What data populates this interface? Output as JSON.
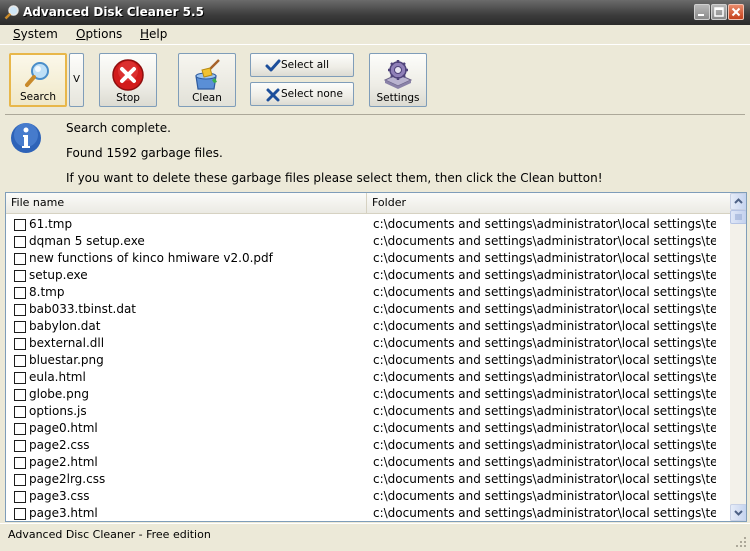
{
  "window": {
    "title": "Advanced Disk Cleaner 5.5"
  },
  "menu": {
    "items": [
      {
        "label": "System",
        "hotkey": "S",
        "rest": "ystem"
      },
      {
        "label": "Options",
        "hotkey": "O",
        "rest": "ptions"
      },
      {
        "label": "Help",
        "hotkey": "H",
        "rest": "elp"
      }
    ]
  },
  "toolbar": {
    "search_label": "Search",
    "dropdown_label": "V",
    "stop_label": "Stop",
    "clean_label": "Clean",
    "select_all_label": "Select all",
    "select_none_label": "Select none",
    "settings_label": "Settings"
  },
  "info": {
    "line1": "Search complete.",
    "line2": "Found 1592 garbage files.",
    "line3": "If you want to delete these garbage files please select them, then click the Clean button!"
  },
  "list": {
    "headers": {
      "file_name": "File name",
      "folder": "Folder"
    },
    "rows": [
      {
        "name": "61.tmp",
        "folder": "c:\\documents and settings\\administrator\\local settings\\te..."
      },
      {
        "name": "dqman 5 setup.exe",
        "folder": "c:\\documents and settings\\administrator\\local settings\\te..."
      },
      {
        "name": "new functions of kinco hmiware v2.0.pdf",
        "folder": "c:\\documents and settings\\administrator\\local settings\\te..."
      },
      {
        "name": "setup.exe",
        "folder": "c:\\documents and settings\\administrator\\local settings\\te..."
      },
      {
        "name": "8.tmp",
        "folder": "c:\\documents and settings\\administrator\\local settings\\te..."
      },
      {
        "name": "bab033.tbinst.dat",
        "folder": "c:\\documents and settings\\administrator\\local settings\\te..."
      },
      {
        "name": "babylon.dat",
        "folder": "c:\\documents and settings\\administrator\\local settings\\te..."
      },
      {
        "name": "bexternal.dll",
        "folder": "c:\\documents and settings\\administrator\\local settings\\te..."
      },
      {
        "name": "bluestar.png",
        "folder": "c:\\documents and settings\\administrator\\local settings\\te..."
      },
      {
        "name": "eula.html",
        "folder": "c:\\documents and settings\\administrator\\local settings\\te..."
      },
      {
        "name": "globe.png",
        "folder": "c:\\documents and settings\\administrator\\local settings\\te..."
      },
      {
        "name": "options.js",
        "folder": "c:\\documents and settings\\administrator\\local settings\\te..."
      },
      {
        "name": "page0.html",
        "folder": "c:\\documents and settings\\administrator\\local settings\\te..."
      },
      {
        "name": "page2.css",
        "folder": "c:\\documents and settings\\administrator\\local settings\\te..."
      },
      {
        "name": "page2.html",
        "folder": "c:\\documents and settings\\administrator\\local settings\\te..."
      },
      {
        "name": "page2lrg.css",
        "folder": "c:\\documents and settings\\administrator\\local settings\\te..."
      },
      {
        "name": "page3.css",
        "folder": "c:\\documents and settings\\administrator\\local settings\\te..."
      },
      {
        "name": "page3.html",
        "folder": "c:\\documents and settings\\administrator\\local settings\\te..."
      }
    ]
  },
  "status": {
    "text": "Advanced Disc Cleaner - Free edition"
  },
  "icons": {
    "app": "magnifier-icon",
    "search": "magnifier-icon",
    "stop": "stop-x-icon",
    "clean": "broom-bucket-icon",
    "select_all": "checkmark-icon",
    "select_none": "x-icon",
    "settings": "gear-disk-icon",
    "info": "info-icon"
  },
  "colors": {
    "titlebar": "#3c3c3c",
    "stop_red": "#d21b1b",
    "info_blue": "#2e63b8",
    "active_border": "#e8b74a"
  }
}
